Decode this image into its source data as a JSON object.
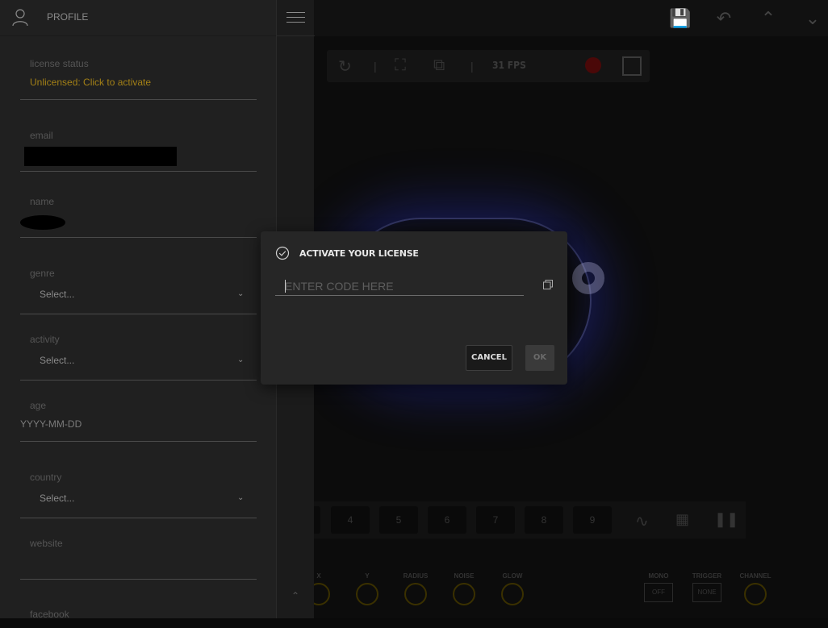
{
  "profile": {
    "title": "PROFILE",
    "fields": {
      "license": {
        "label": "license status",
        "value": "Unlicensed: Click to activate"
      },
      "email": {
        "label": "email"
      },
      "name": {
        "label": "name"
      },
      "genre": {
        "label": "genre",
        "value": "Select..."
      },
      "activity": {
        "label": "activity",
        "value": "Select..."
      },
      "age": {
        "label": "age",
        "value": "YYYY-MM-DD"
      },
      "country": {
        "label": "country",
        "value": "Select..."
      },
      "website": {
        "label": "website"
      },
      "facebook": {
        "label": "facebook"
      }
    }
  },
  "toolbar": {
    "fps": "31 FPS"
  },
  "pads": [
    "4",
    "5",
    "6",
    "7",
    "8",
    "9"
  ],
  "knobs": [
    {
      "label": "X"
    },
    {
      "label": "Y"
    },
    {
      "label": "RADIUS"
    },
    {
      "label": "NOISE"
    },
    {
      "label": "GLOW"
    },
    {
      "label": "MONO",
      "value": "OFF"
    },
    {
      "label": "TRIGGER",
      "value": "NONE"
    },
    {
      "label": "CHANNEL"
    }
  ],
  "dialog": {
    "title": "ACTIVATE YOUR LICENSE",
    "placeholder": "ENTER CODE HERE",
    "value": "",
    "cancel_label": "CANCEL",
    "ok_label": "OK"
  },
  "colors": {
    "license_status": "#a38016",
    "panel_bg": "#202020",
    "dialog_bg": "#262626"
  }
}
